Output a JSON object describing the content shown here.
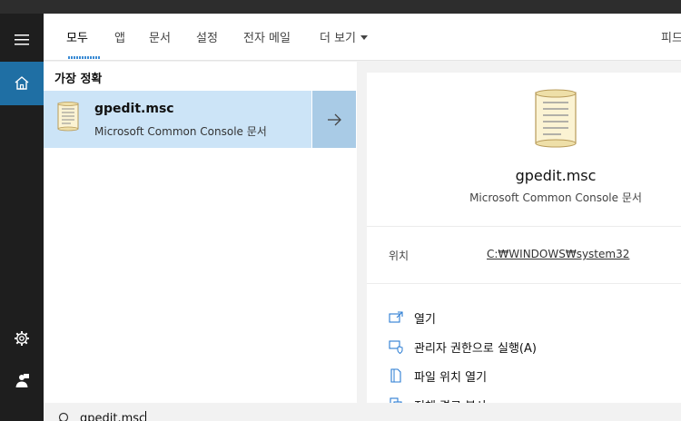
{
  "tabs": {
    "all": "모두",
    "apps": "앱",
    "documents": "문서",
    "settings": "설정",
    "email": "전자 메일",
    "more": "더 보기",
    "feedback": "피드"
  },
  "results": {
    "section_title": "가장 정확",
    "best_match": {
      "name": "gpedit.msc",
      "type": "Microsoft Common Console 문서"
    }
  },
  "detail": {
    "name": "gpedit.msc",
    "type": "Microsoft Common Console 문서",
    "location_label": "위치",
    "location_value": "C:₩WINDOWS₩system32",
    "actions": [
      {
        "label": "열기",
        "icon": "open-icon"
      },
      {
        "label": "관리자 권한으로 실행(A)",
        "icon": "run-as-admin-icon"
      },
      {
        "label": "파일 위치 열기",
        "icon": "file-location-icon"
      },
      {
        "label": "전체 경로 복사",
        "icon": "copy-path-icon"
      }
    ]
  },
  "search": {
    "query": "gpedit.msc"
  },
  "colors": {
    "accent": "#1f6fa4",
    "selection": "#cce4f7",
    "selection_arrow": "#a9cbe6",
    "action_icon": "#2b7cd3"
  }
}
